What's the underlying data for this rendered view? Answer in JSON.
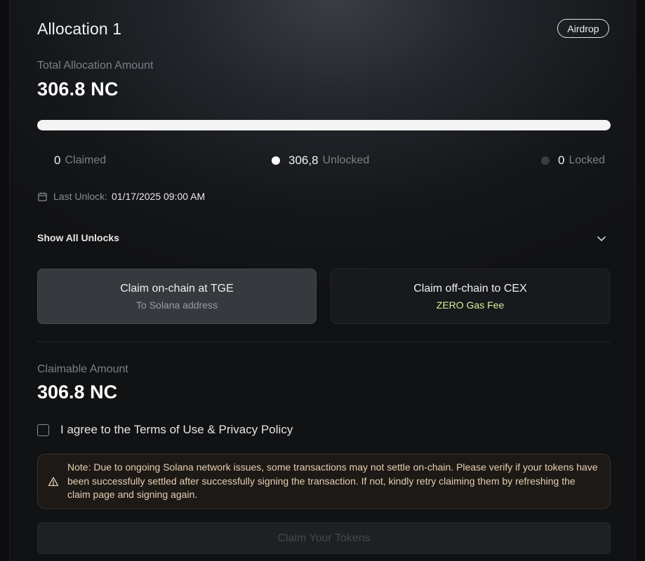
{
  "header": {
    "title": "Allocation 1",
    "badge": "Airdrop"
  },
  "total": {
    "label": "Total Allocation Amount",
    "amount": "306.8 NC",
    "progress_fraction": 1.0
  },
  "stats": {
    "claimed": {
      "value": "0",
      "label": "Claimed"
    },
    "unlocked": {
      "value": "306,8",
      "label": "Unlocked",
      "dot_color": "#ffffff"
    },
    "locked": {
      "value": "0",
      "label": "Locked",
      "dot_color": "#3a3c40"
    }
  },
  "last_unlock": {
    "icon": "calendar-icon",
    "label": "Last Unlock:",
    "value": "01/17/2025 09:00 AM"
  },
  "show_all": {
    "label": "Show All Unlocks",
    "icon": "chevron-down-icon"
  },
  "claim_options": {
    "onchain": {
      "title": "Claim on-chain at TGE",
      "subtitle": "To Solana address"
    },
    "offchain": {
      "title": "Claim off-chain to CEX",
      "subtitle": "ZERO Gas Fee",
      "accent": "#d9f09a"
    }
  },
  "claimable": {
    "label": "Claimable Amount",
    "amount": "306.8 NC"
  },
  "agree": {
    "label": "I agree to the Terms of Use & Privacy Policy",
    "checked": false
  },
  "note": {
    "icon": "warning-icon",
    "text": "Note: Due to ongoing Solana network issues, some transactions may not settle on-chain. Please verify if your tokens have been successfully settled after successfully signing the transaction. If not, kindly retry claiming them by refreshing the claim page and signing again."
  },
  "submit": {
    "label": "Claim Your Tokens",
    "disabled": true
  }
}
